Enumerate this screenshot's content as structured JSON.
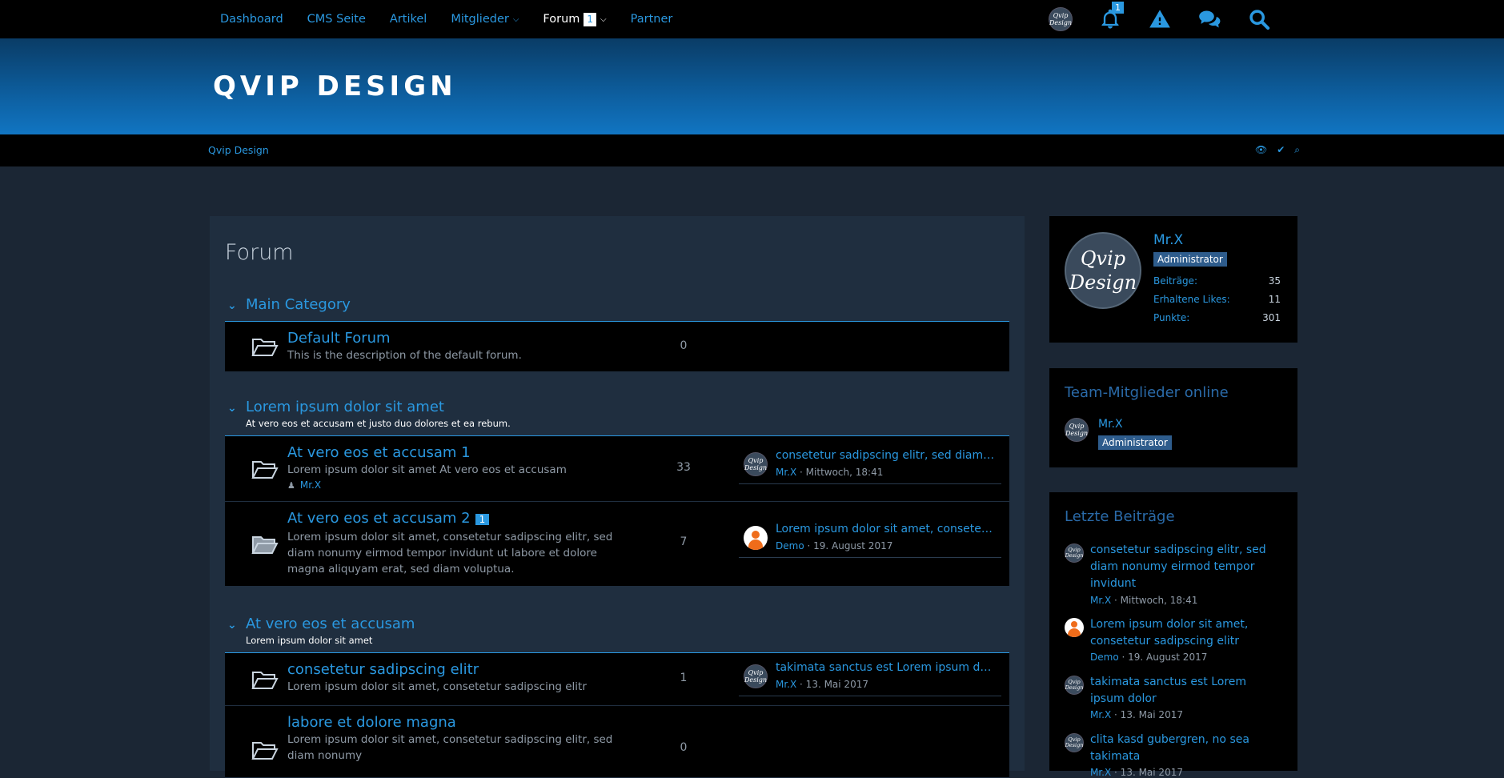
{
  "nav": {
    "items": [
      {
        "label": "Dashboard"
      },
      {
        "label": "CMS Seite"
      },
      {
        "label": "Artikel"
      },
      {
        "label": "Mitglieder"
      },
      {
        "label": "Forum",
        "badge": "1"
      },
      {
        "label": "Partner"
      }
    ],
    "notification_count": "1",
    "avatar_text": "Qvip Design"
  },
  "header": {
    "logo": "QVIP DESIGN"
  },
  "breadcrumb": {
    "label": "Qvip Design"
  },
  "main": {
    "title": "Forum",
    "categories": [
      {
        "title": "Main Category",
        "desc": "",
        "boards": [
          {
            "title": "Default Forum",
            "desc": "This is the description of the default forum.",
            "count": "0"
          }
        ]
      },
      {
        "title": "Lorem ipsum dolor sit amet",
        "desc": "At vero eos et accusam et justo duo dolores et ea rebum.",
        "boards": [
          {
            "title": "At vero eos et accusam 1",
            "desc": "Lorem ipsum dolor sit amet At vero eos et accusam",
            "moderator": "Mr.X",
            "count": "33",
            "last_title": "consetetur sadipscing elitr, sed diam nonumy eirmod tempor invidunt",
            "last_user": "Mr.X",
            "last_time": " · Mittwoch, 18:41"
          },
          {
            "title": "At vero eos et accusam 2",
            "badge": "1",
            "desc": "Lorem ipsum dolor sit amet, consetetur sadipscing elitr, sed diam nonumy eirmod tempor invidunt ut labore et dolore magna aliquyam erat, sed diam voluptua.",
            "count": "7",
            "last_title": "Lorem ipsum dolor sit amet, consetetur sadipscing elitr",
            "last_user": "Demo",
            "last_time": " · 19. August 2017"
          }
        ]
      },
      {
        "title": "At vero eos et accusam",
        "desc": "Lorem ipsum dolor sit amet",
        "boards": [
          {
            "title": "consetetur sadipscing elitr",
            "desc": "Lorem ipsum dolor sit amet, consetetur sadipscing elitr",
            "count": "1",
            "last_title": "takimata sanctus est Lorem ipsum dolor",
            "last_user": "Mr.X",
            "last_time": " · 13. Mai 2017"
          },
          {
            "title": "labore et dolore magna",
            "desc": "Lorem ipsum dolor sit amet, consetetur sadipscing elitr, sed diam nonumy",
            "count": "0"
          }
        ]
      }
    ]
  },
  "sidebar": {
    "profile": {
      "name": "Mr.X",
      "role": "Administrator",
      "avatar_text": "Qvip Design",
      "stats": [
        {
          "label": "Beiträge:",
          "value": "35"
        },
        {
          "label": "Erhaltene Likes:",
          "value": "11"
        },
        {
          "label": "Punkte:",
          "value": "301"
        }
      ]
    },
    "team": {
      "title": "Team-Mitglieder online",
      "member": "Mr.X",
      "role": "Administrator"
    },
    "recent": {
      "title": "Letzte Beiträge",
      "posts": [
        {
          "title": "consetetur sadipscing elitr, sed diam nonumy eirmod tempor invidunt",
          "user": "Mr.X",
          "time": " · Mittwoch, 18:41"
        },
        {
          "title": "Lorem ipsum dolor sit amet, consetetur sadipscing elitr",
          "user": "Demo",
          "time": " · 19. August 2017"
        },
        {
          "title": "takimata sanctus est Lorem ipsum dolor",
          "user": "Mr.X",
          "time": " · 13. Mai 2017"
        },
        {
          "title": "clita kasd gubergren, no sea takimata",
          "user": "Mr.X",
          "time": " · 13. Mai 2017"
        }
      ]
    }
  }
}
